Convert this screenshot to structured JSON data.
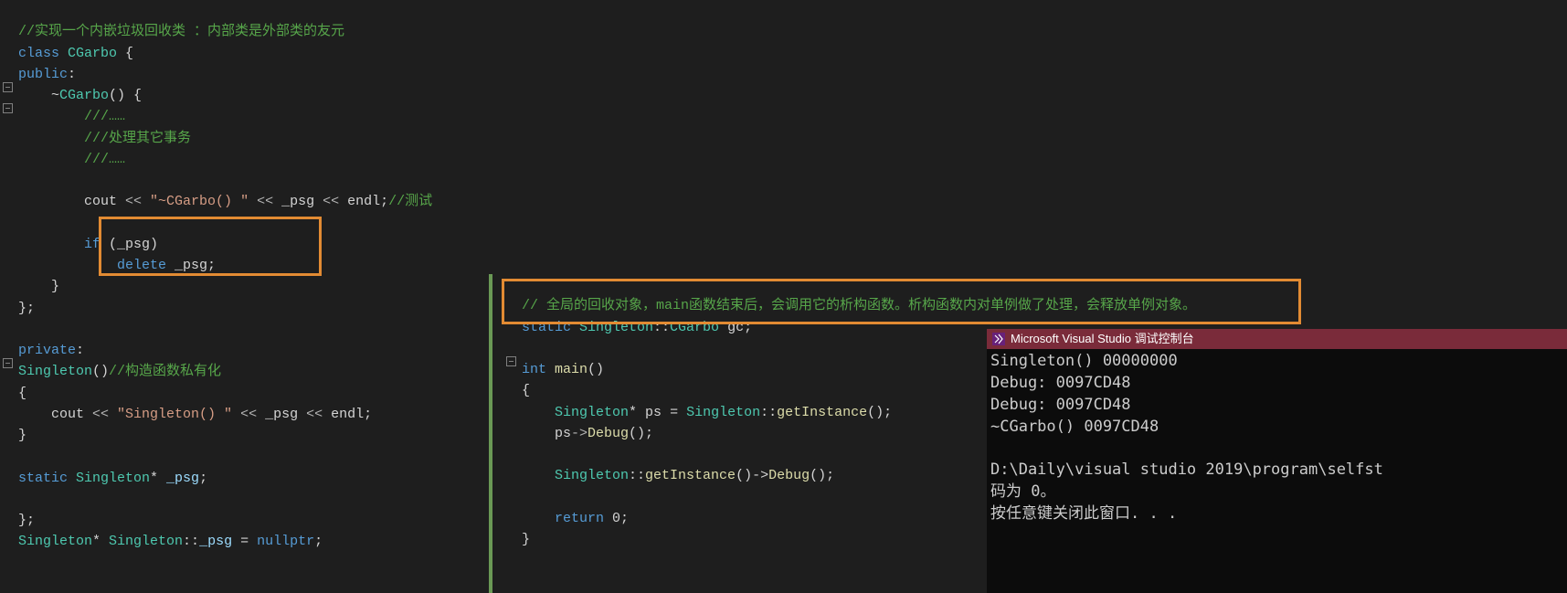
{
  "left": {
    "line1_comment": "//实现一个内嵌垃圾回收类 ：内部类是外部类的友元",
    "line2_kw_class": "class",
    "line2_type": " CGarbo ",
    "line2_brace": "{",
    "line3_kw": "public",
    "line3_colon": ":",
    "line4_dtor": "    ~",
    "line4_type": "CGarbo",
    "line4_rest": "() {",
    "line5_comment": "        ///……",
    "line6_comment": "        ///处理其它事务",
    "line7_comment": "        ///……",
    "blank8": "",
    "line9_pre": "        cout ",
    "line9_op1": "<<",
    "line9_str": " \"~CGarbo() \" ",
    "line9_op2": "<<",
    "line9_psg": " _psg ",
    "line9_op3": "<<",
    "line9_end": " endl;",
    "line9_comment": "//测试",
    "blank10": "",
    "line11_if": "        if",
    "line11_rest": " (_psg)",
    "line12_del": "            delete",
    "line12_rest": " _psg;",
    "line13": "    }",
    "line14": "};",
    "blank15": "",
    "line16_kw": "private",
    "line16_colon": ":",
    "line17_type": "Singleton",
    "line17_rest": "()",
    "line17_comment": "//构造函数私有化",
    "line18": "{",
    "line19_pre": "    cout ",
    "line19_op1": "<<",
    "line19_str": " \"Singleton() \" ",
    "line19_op2": "<<",
    "line19_psg": " _psg ",
    "line19_op3": "<<",
    "line19_end": " endl;",
    "line20": "}",
    "blank21": "",
    "line22_kw": "static",
    "line22_type": " Singleton",
    "line22_ptr": "* ",
    "line22_field": "_psg",
    "line22_semi": ";",
    "blank23": "",
    "line24": "};",
    "line25_type1": "Singleton",
    "line25_ptr": "* ",
    "line25_type2": "Singleton",
    "line25_scope": "::",
    "line25_field": "_psg",
    "line25_assign": " = ",
    "line25_kw": "nullptr",
    "line25_semi": ";"
  },
  "right": {
    "line1_comment": "// 全局的回收对象，main函数结束后，会调用它的析构函数。析构函数内对单例做了处理，会释放单例对象。",
    "line2_kw": "static",
    "line2_type1": " Singleton",
    "line2_scope": "::",
    "line2_type2": "CGarbo",
    "line2_var": " gc",
    "line2_semi": ";",
    "blank3": "",
    "line4_kw": "int",
    "line4_main": " main",
    "line4_paren": "()",
    "line5": "{",
    "line6_pre": "    ",
    "line6_type": "Singleton",
    "line6_ptr": "* ",
    "line6_var": "ps",
    "line6_eq": " = ",
    "line6_type2": "Singleton",
    "line6_scope": "::",
    "line6_func": "getInstance",
    "line6_rest": "();",
    "line7_pre": "    ps",
    "line7_arrow": "->",
    "line7_func": "Debug",
    "line7_rest": "();",
    "blank8": "",
    "line9_pre": "    ",
    "line9_type": "Singleton",
    "line9_scope": "::",
    "line9_func1": "getInstance",
    "line9_mid": "()->",
    "line9_func2": "Debug",
    "line9_rest": "();",
    "blank10": "",
    "line11_pre": "    ",
    "line11_kw": "return",
    "line11_rest": " 0;",
    "line12": "}"
  },
  "console": {
    "title": "Microsoft Visual Studio 调试控制台",
    "out1": "Singleton() 00000000",
    "out2": "Debug: 0097CD48",
    "out3": "Debug: 0097CD48",
    "out4": "~CGarbo() 0097CD48",
    "blank": "",
    "out5": "D:\\Daily\\visual studio 2019\\program\\selfst",
    "out6": "码为 0。",
    "out7": "按任意键关闭此窗口. . ."
  }
}
